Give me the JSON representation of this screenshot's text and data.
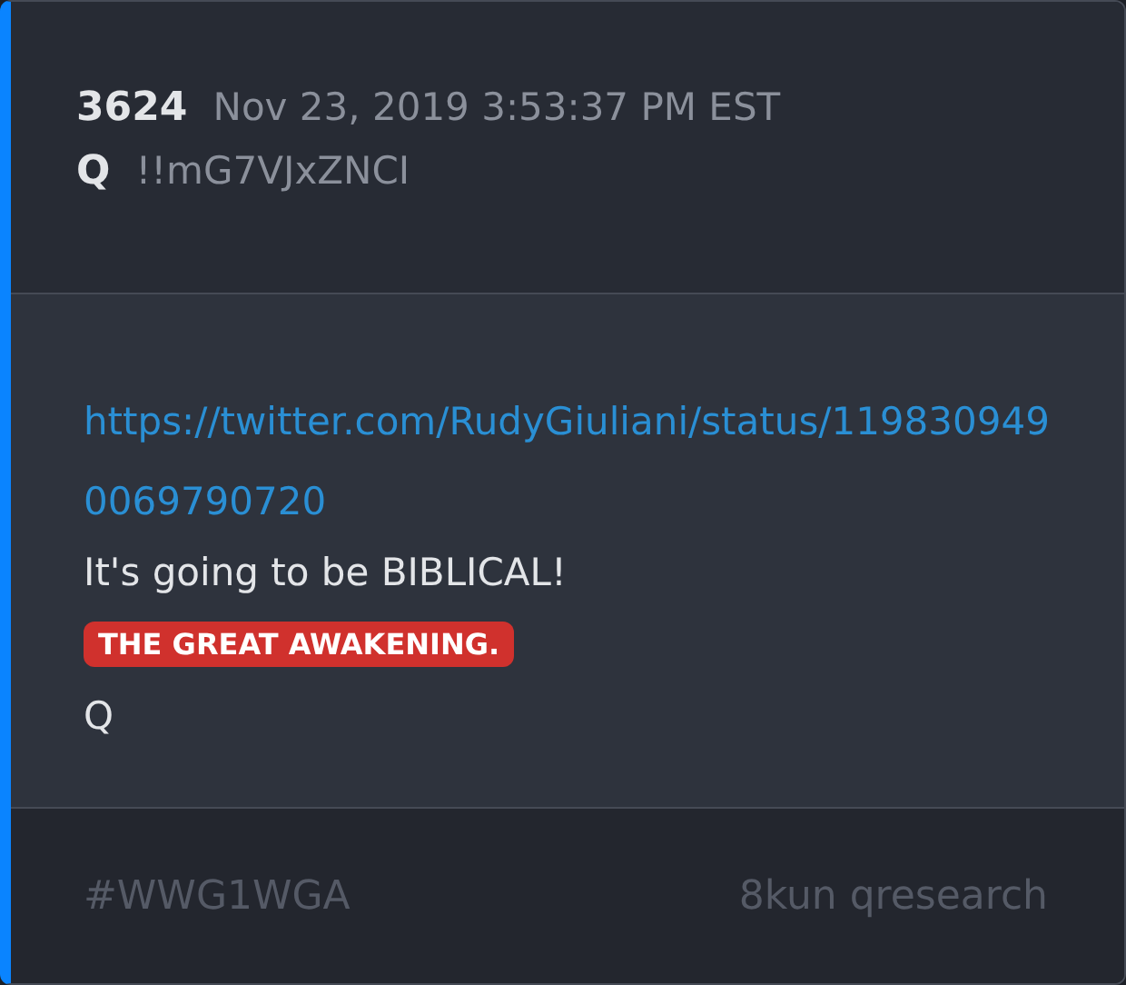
{
  "post": {
    "number": "3624",
    "timestamp": "Nov 23, 2019 3:53:37 PM EST",
    "author": "Q",
    "tripcode": "!!mG7VJxZNCI"
  },
  "body": [
    {
      "kind": "link",
      "text": "https://twitter.com/RudyGiuliani/status/1198309490069790720"
    },
    {
      "kind": "text",
      "text": "It's going to be BIBLICAL!"
    },
    {
      "kind": "tag",
      "text": "THE GREAT AWAKENING."
    },
    {
      "kind": "text",
      "text": "Q"
    }
  ],
  "footer": {
    "hashtag": "#WWG1WGA",
    "source": "8kun qresearch"
  }
}
